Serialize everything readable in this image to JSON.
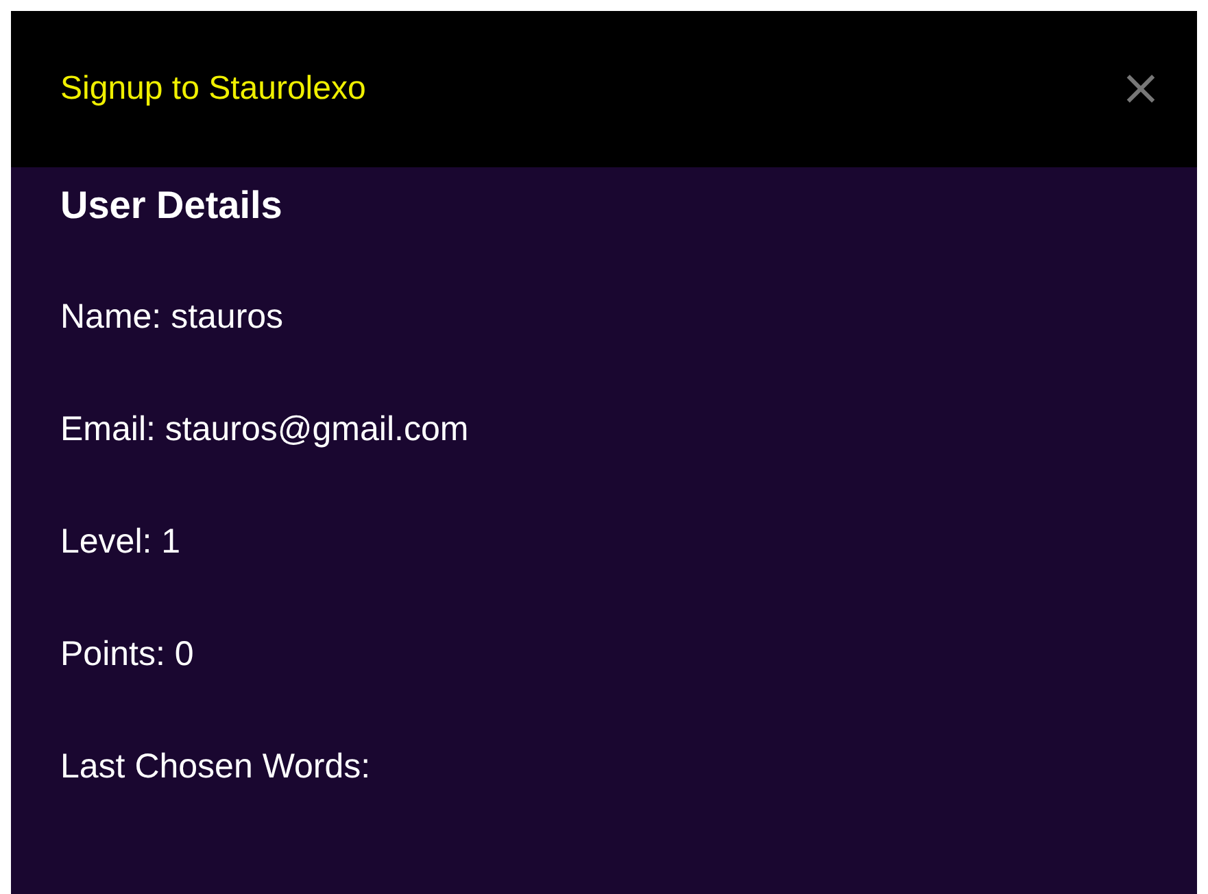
{
  "dialog": {
    "title": "Signup to Staurolexo",
    "close": "×"
  },
  "section": {
    "heading": "User Details",
    "fields": [
      {
        "text": "Name: stauros"
      },
      {
        "text": "Email: stauros@gmail.com"
      },
      {
        "text": "Level: 1"
      },
      {
        "text": "Points: 0"
      },
      {
        "text": "Last Chosen Words:"
      }
    ]
  }
}
